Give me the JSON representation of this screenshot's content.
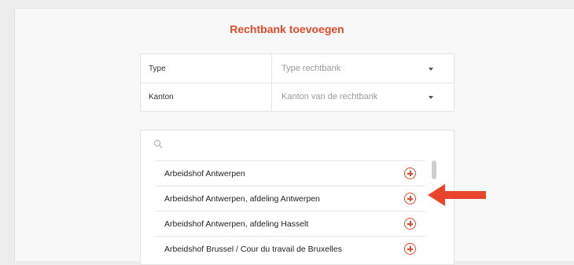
{
  "dialog": {
    "title": "Rechtbank toevoegen"
  },
  "form": {
    "type_label": "Type",
    "type_placeholder": "Type rechtbank",
    "canton_label": "Kanton",
    "canton_placeholder": "Kanton van de rechtbank"
  },
  "list": {
    "search_placeholder": "",
    "items": [
      {
        "label": "Arbeidshof Antwerpen"
      },
      {
        "label": "Arbeidshof Antwerpen, afdeling Antwerpen"
      },
      {
        "label": "Arbeidshof Antwerpen, afdeling Hasselt"
      },
      {
        "label": "Arbeidshof Brussel / Cour du travail de Bruxelles"
      }
    ]
  },
  "colors": {
    "accent": "#e04a2b",
    "arrow": "#e8452c"
  },
  "icons": {
    "search": "search-icon",
    "add": "plus-circle-icon",
    "caret": "chevron-down-icon",
    "pointer": "arrow-left-icon"
  }
}
